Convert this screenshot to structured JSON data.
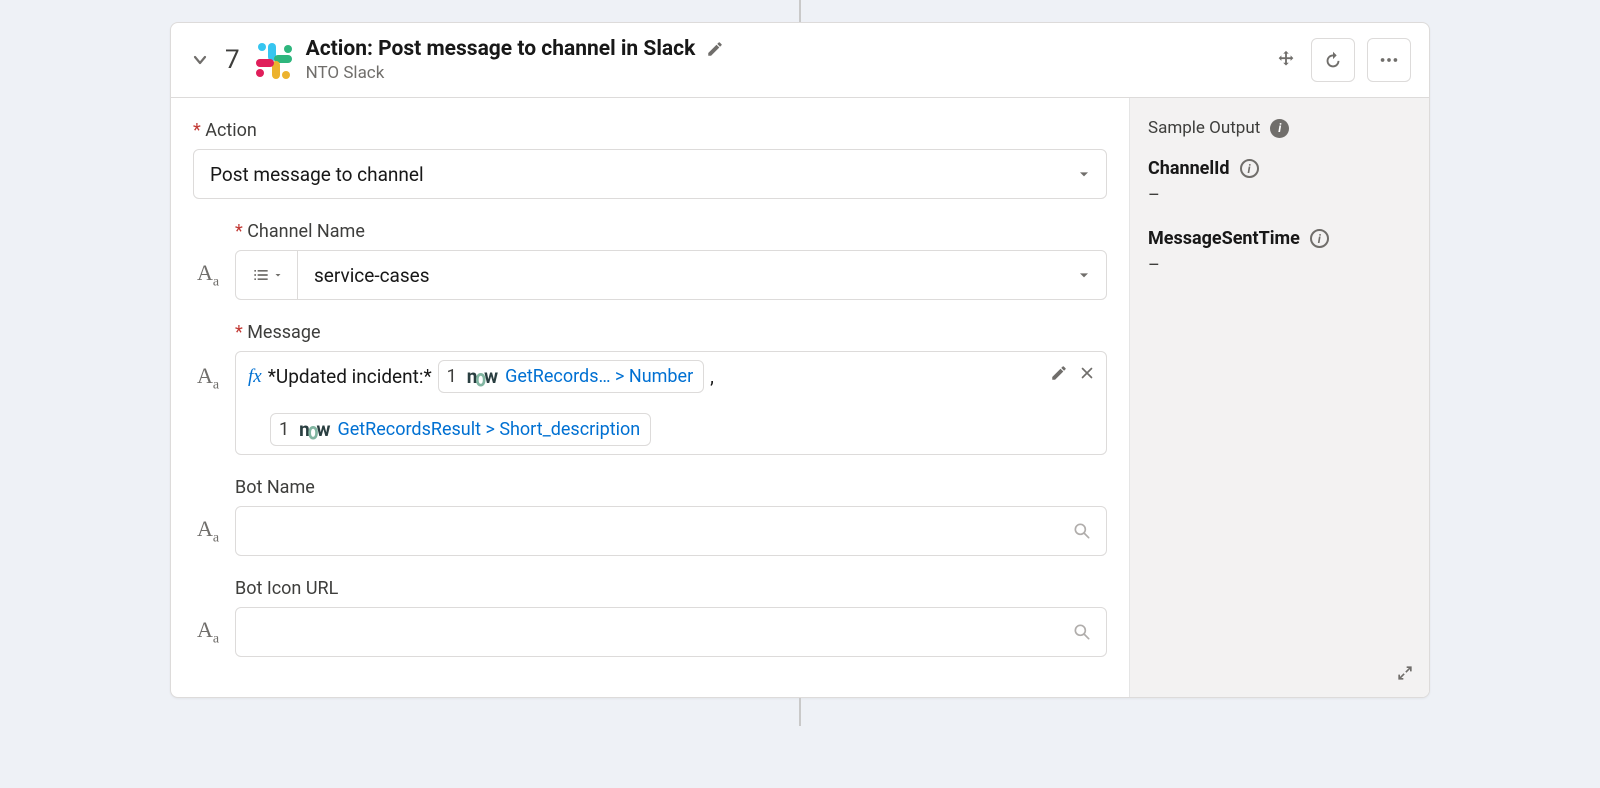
{
  "header": {
    "step_number": "7",
    "title": "Action: Post message to channel in Slack",
    "subtitle": "NTO Slack"
  },
  "form": {
    "action": {
      "label": "Action",
      "value": "Post message to channel"
    },
    "channel_name": {
      "label": "Channel Name",
      "value": "service-cases"
    },
    "message": {
      "label": "Message",
      "static_prefix": "*Updated incident:*",
      "pill1_num": "1",
      "pill1_text": "GetRecords…  > Number",
      "comma": ",",
      "pill2_num": "1",
      "pill2_text": "GetRecordsResult > Short_description"
    },
    "bot_name": {
      "label": "Bot Name"
    },
    "bot_icon_url": {
      "label": "Bot Icon URL"
    }
  },
  "output": {
    "heading": "Sample Output",
    "channel_id": {
      "key": "ChannelId",
      "value": "–"
    },
    "message_sent_time": {
      "key": "MessageSentTime",
      "value": "–"
    }
  }
}
